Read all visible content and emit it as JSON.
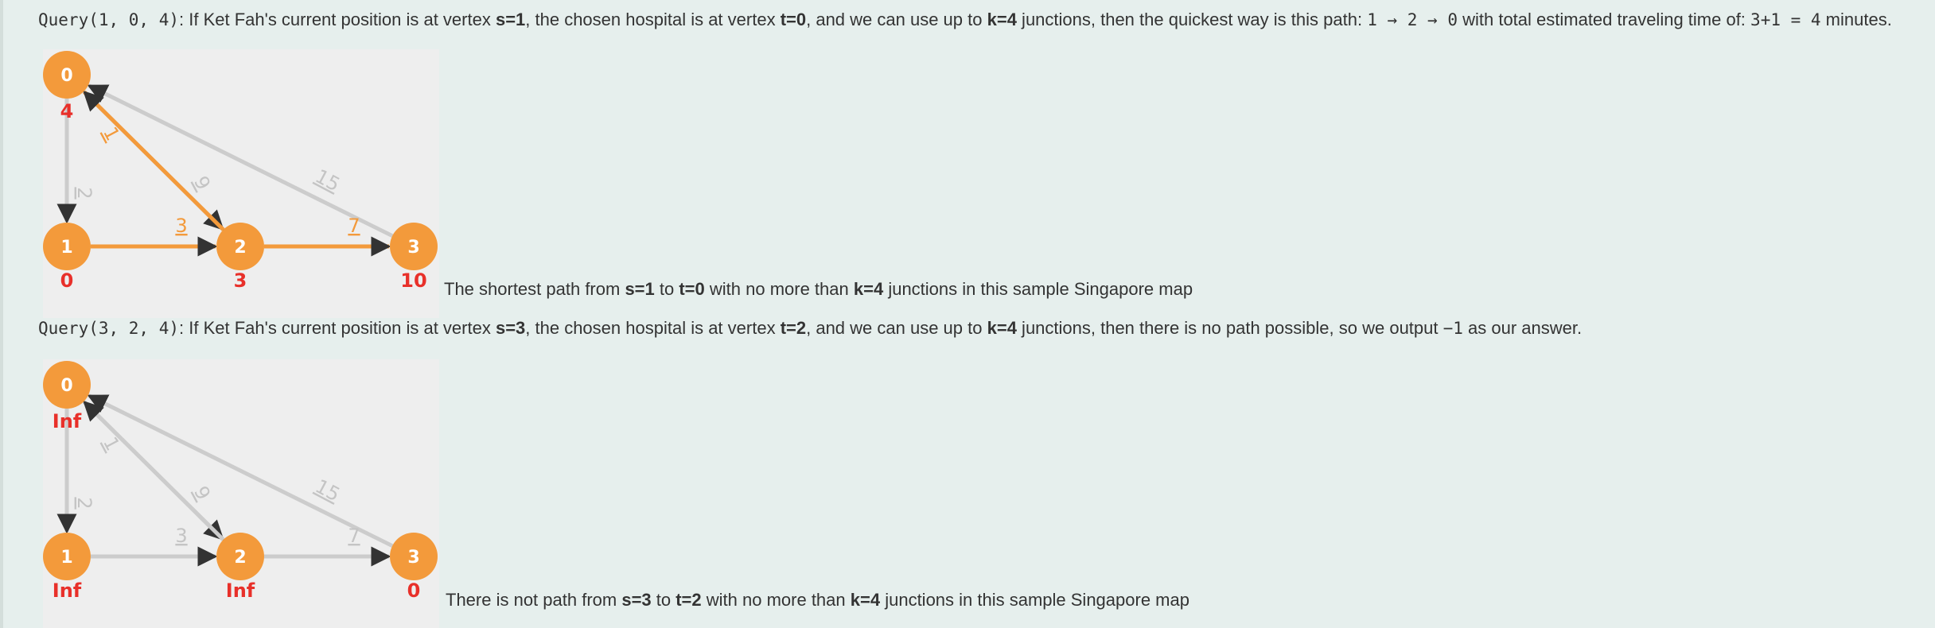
{
  "query1": {
    "code": "Query(1, 0, 4)",
    "t1": ": If Ket Fah's current position is at vertex ",
    "s": "s=1",
    "t2": ", the chosen hospital is at vertex ",
    "t": "t=0",
    "t3": ", and we can use up to ",
    "k": "k=4",
    "t4": " junctions, then the quickest way is this path: ",
    "path": "1 → 2 → 0",
    "t5": " with total estimated traveling time of: ",
    "total_calc": "3+1 = 4",
    "t6": " minutes."
  },
  "graph1": {
    "vertices": [
      {
        "id": "0",
        "dist": "4"
      },
      {
        "id": "1",
        "dist": "0"
      },
      {
        "id": "2",
        "dist": "3"
      },
      {
        "id": "3",
        "dist": "10"
      }
    ],
    "edges": [
      {
        "from": "0",
        "to": "1",
        "weight": "2",
        "highlight": false
      },
      {
        "from": "0",
        "to": "2",
        "weight": "9",
        "highlight": false
      },
      {
        "from": "3",
        "to": "0",
        "weight": "15",
        "highlight": false
      },
      {
        "from": "1",
        "to": "2",
        "weight": "3",
        "highlight": true
      },
      {
        "from": "2",
        "to": "3",
        "weight": "7",
        "highlight": true
      },
      {
        "from": "2",
        "to": "0",
        "weight": "1",
        "highlight": true
      }
    ],
    "caption": {
      "c1": "The shortest path from ",
      "s": "s=1",
      "c2": " to ",
      "t": "t=0",
      "c3": " with no more than ",
      "k": "k=4",
      "c4": " junctions in this sample Singapore map"
    }
  },
  "query2": {
    "code": "Query(3, 2, 4)",
    "t1": ": If Ket Fah's current position is at vertex ",
    "s": "s=3",
    "t2": ", the chosen hospital is at vertex ",
    "t": "t=2",
    "t3": ", and we can use up to ",
    "k": "k=4",
    "t4": " junctions, then there is no path possible, so we output ",
    "output": "−1",
    "t5": " as our answer."
  },
  "graph2": {
    "vertices": [
      {
        "id": "0",
        "dist": "Inf"
      },
      {
        "id": "1",
        "dist": "Inf"
      },
      {
        "id": "2",
        "dist": "Inf"
      },
      {
        "id": "3",
        "dist": "0"
      }
    ],
    "edges": [
      {
        "from": "0",
        "to": "1",
        "weight": "2",
        "highlight": false
      },
      {
        "from": "0",
        "to": "2",
        "weight": "9",
        "highlight": false
      },
      {
        "from": "3",
        "to": "0",
        "weight": "15",
        "highlight": false
      },
      {
        "from": "1",
        "to": "2",
        "weight": "3",
        "highlight": false
      },
      {
        "from": "2",
        "to": "3",
        "weight": "7",
        "highlight": false
      },
      {
        "from": "2",
        "to": "0",
        "weight": "1",
        "highlight": false
      }
    ],
    "caption": {
      "c1": "There is not path from ",
      "s": "s=3",
      "c2": " to ",
      "t": "t=2",
      "c3": " with no more than ",
      "k": "k=4",
      "c4": " junctions in this sample Singapore map"
    }
  },
  "colors": {
    "background": "#e6efed",
    "graph_bg": "#eeeeee",
    "vertex_fill": "#f39a3b",
    "highlight_edge": "#f39a3b",
    "normal_edge": "#cccccc",
    "dist_label": "#e8302a"
  }
}
